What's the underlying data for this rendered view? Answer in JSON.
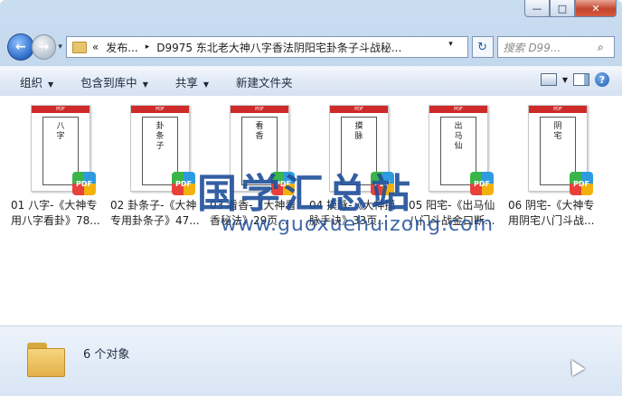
{
  "window": {
    "controls": {
      "minimize": "—",
      "maximize": "□",
      "close": "✕"
    }
  },
  "nav": {
    "back_icon": "←",
    "forward_icon": "→",
    "history_icon": "▾",
    "breadcrumb": {
      "overflow": "«",
      "parent": "发布...",
      "current": "D9975 东北老大神八字香法阴阳宅卦条子斗战秘..."
    },
    "refresh_icon": "↻",
    "search_placeholder": "搜索 D99..."
  },
  "toolbar": {
    "organize": "组织",
    "include_library": "包含到库中",
    "share": "共享",
    "new_folder": "新建文件夹"
  },
  "files": [
    {
      "thumb_text": "八字",
      "name_line1": "01 八字-《大神专",
      "name_line2": "用八字看卦》78..."
    },
    {
      "thumb_text": "卦条子",
      "name_line1": "02 卦条子-《大神",
      "name_line2": "专用卦条子》47..."
    },
    {
      "thumb_text": "看香",
      "name_line1": "03 看香-《大神看",
      "name_line2": "香秘法》29页..."
    },
    {
      "thumb_text": "摸脉",
      "name_line1": "04 摸脉-《大神摸",
      "name_line2": "脉手诀》33页..."
    },
    {
      "thumb_text": "出马仙",
      "name_line1": "05 阳宅-《出马仙",
      "name_line2": "八门斗战金口断..."
    },
    {
      "thumb_text": "阴宅",
      "name_line1": "06 阴宅-《大神专",
      "name_line2": "用阴宅八门斗战..."
    }
  ],
  "pdf_badge_label": "PDF",
  "thumb_header": "PDF",
  "watermark": {
    "title": "国学汇总站",
    "url": "www.guoxuehuizong.com"
  },
  "status": {
    "count": "6 个对象"
  },
  "icons": {
    "folder": "folder-icon",
    "pdf": "pdf-icon",
    "search": "search-icon"
  }
}
